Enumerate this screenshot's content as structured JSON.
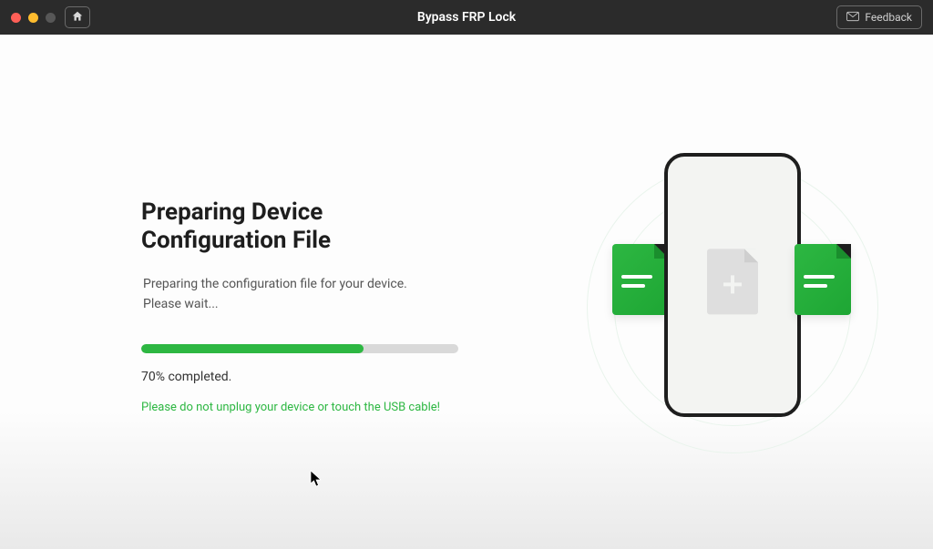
{
  "colors": {
    "accent": "#2db742"
  },
  "titlebar": {
    "title": "Bypass FRP Lock",
    "feedback_label": "Feedback"
  },
  "main": {
    "heading_line1": "Preparing Device",
    "heading_line2": "Configuration File",
    "description_line1": "Preparing the configuration file for your device.",
    "description_line2": "Please wait...",
    "progress_percent": 70,
    "progress_label": "70% completed.",
    "warning": "Please do not unplug your device or touch the USB cable!"
  }
}
